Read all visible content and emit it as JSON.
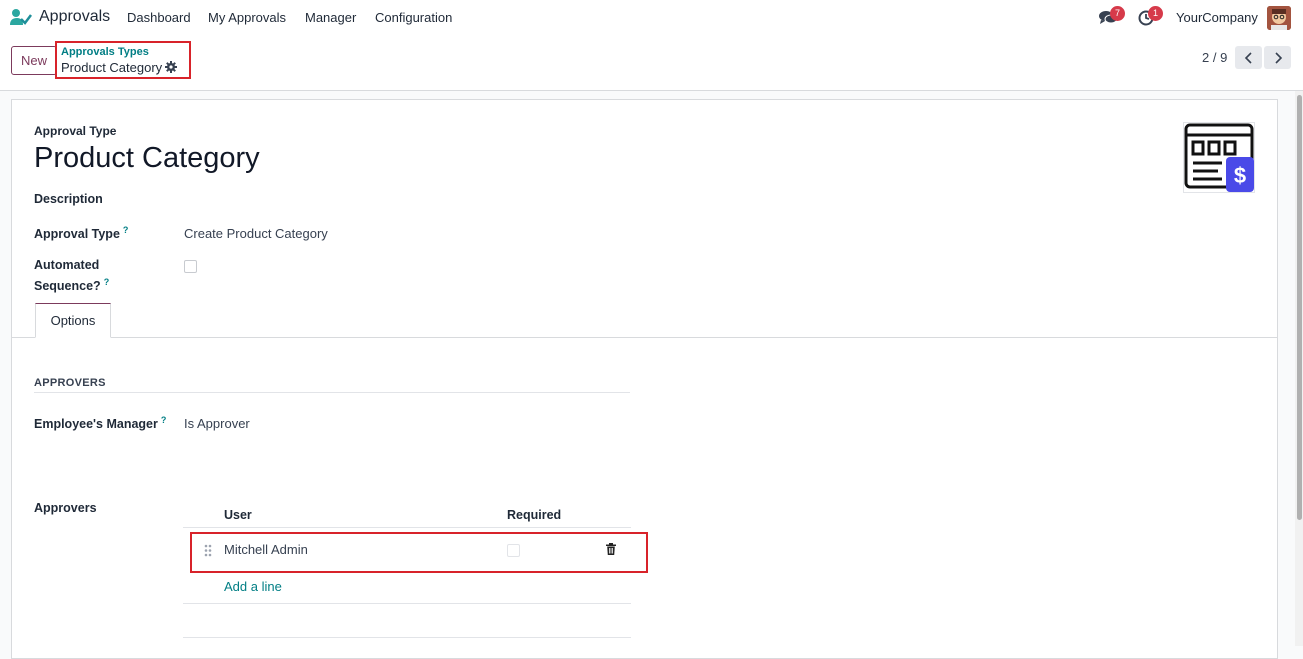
{
  "topnav": {
    "app_name": "Approvals",
    "menu": [
      "Dashboard",
      "My Approvals",
      "Manager",
      "Configuration"
    ],
    "messages_count": "7",
    "activities_count": "1",
    "company": "YourCompany"
  },
  "controlbar": {
    "new_label": "New",
    "breadcrumb_parent": "Approvals Types",
    "breadcrumb_current": "Product Category",
    "pager": "2 / 9"
  },
  "form": {
    "type_label": "Approval Type",
    "title": "Product Category",
    "description_label": "Description",
    "approval_type_label": "Approval Type",
    "approval_type_value": "Create Product Category",
    "automated_label_1": "Automated",
    "automated_label_2": "Sequence?",
    "help_mark": "?"
  },
  "tabs": {
    "options": "Options"
  },
  "options": {
    "section_title": "APPROVERS",
    "manager_label": "Employee's Manager",
    "manager_value": "Is Approver",
    "approvers_label": "Approvers",
    "table_headers": [
      "User",
      "Required"
    ],
    "rows": [
      {
        "user": "Mitchell Admin"
      }
    ],
    "add_line": "Add a line"
  },
  "colors": {
    "accent": "#017e84",
    "brand": "#7c3a5c",
    "highlight": "#d8232a",
    "badge": "#d63a4a"
  }
}
